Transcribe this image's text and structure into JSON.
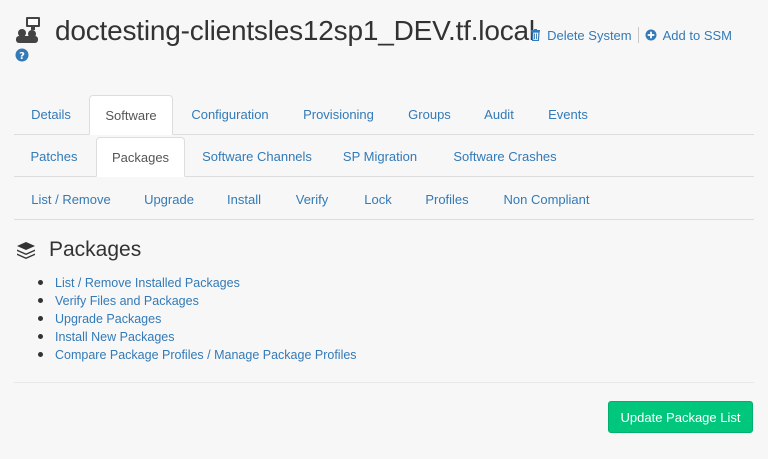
{
  "header": {
    "system_name": "doctesting-clientsles12sp1_DEV.tf.local",
    "actions": [
      {
        "label": "Delete System",
        "icon": "trash-icon"
      },
      {
        "label": "Add to SSM",
        "icon": "plus-circle-icon"
      }
    ]
  },
  "tabs_level1": [
    {
      "label": "Details",
      "active": false
    },
    {
      "label": "Software",
      "active": true
    },
    {
      "label": "Configuration",
      "active": false
    },
    {
      "label": "Provisioning",
      "active": false
    },
    {
      "label": "Groups",
      "active": false
    },
    {
      "label": "Audit",
      "active": false
    },
    {
      "label": "Events",
      "active": false
    }
  ],
  "tabs_level2": [
    {
      "label": "Patches",
      "active": false
    },
    {
      "label": "Packages",
      "active": true
    },
    {
      "label": "Software Channels",
      "active": false
    },
    {
      "label": "SP Migration",
      "active": false
    },
    {
      "label": "Software Crashes",
      "active": false
    }
  ],
  "tabs_level3": [
    {
      "label": "List / Remove",
      "active": false
    },
    {
      "label": "Upgrade",
      "active": false
    },
    {
      "label": "Install",
      "active": false
    },
    {
      "label": "Verify",
      "active": false
    },
    {
      "label": "Lock",
      "active": false
    },
    {
      "label": "Profiles",
      "active": false
    },
    {
      "label": "Non Compliant",
      "active": false
    }
  ],
  "section": {
    "title": "Packages",
    "icon": "packages-stack-icon",
    "links": [
      "List / Remove Installed Packages",
      "Verify Files and Packages",
      "Upgrade Packages",
      "Install New Packages",
      "Compare Package Profiles / Manage Package Profiles"
    ]
  },
  "update_button": {
    "label": "Update Package List"
  },
  "colors": {
    "link": "#337ab7",
    "button": "#00c77c",
    "text": "#333333"
  }
}
